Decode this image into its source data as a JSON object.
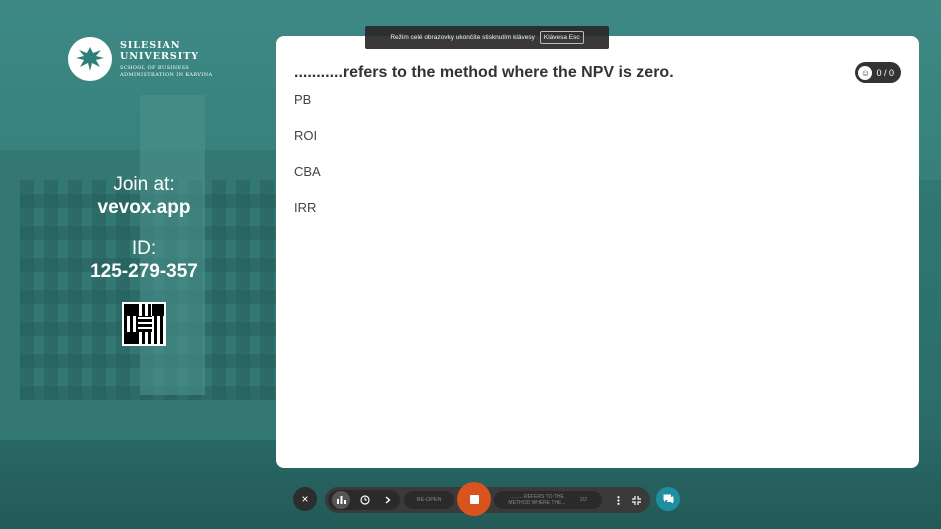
{
  "logo": {
    "line1": "SILESIAN",
    "line2": "UNIVERSITY",
    "line3": "SCHOOL OF BUSINESS",
    "line4": "ADMINISTRATION IN KARVINA"
  },
  "join": {
    "join_label": "Join at:",
    "join_url": "vevox.app",
    "id_label": "ID:",
    "id_value": "125-279-357"
  },
  "fullscreen_notice": {
    "message": "Režim celé obrazovky ukončíte stisknutím klávesy",
    "key_label": "Klávesa Esc"
  },
  "question": {
    "title": "...........refers to the method where the NPV is zero.",
    "response_count": "0 / 0",
    "options": [
      "PB",
      "ROI",
      "CBA",
      "IRR"
    ]
  },
  "toolbar": {
    "close_icon": "×",
    "reopen_label": "RE-OPEN",
    "question_preview": "..........REFERS TO THE METHOD WHERE THE...",
    "position": "2/2"
  },
  "colors": {
    "accent": "#d9531e",
    "chat": "#1e8fa0",
    "background": "#2f6f6c"
  }
}
